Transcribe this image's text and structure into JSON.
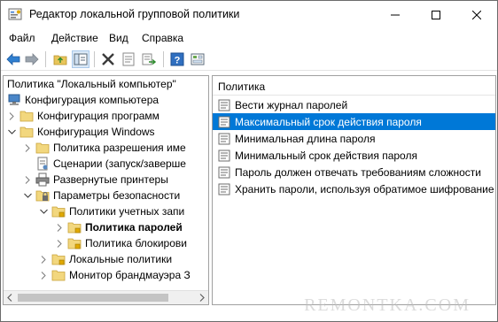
{
  "window": {
    "title": "Редактор локальной групповой политики"
  },
  "menu": {
    "items": [
      "Файл",
      "Действие",
      "Вид",
      "Справка"
    ]
  },
  "left_pane": {
    "header": "Политика \"Локальный компьютер\"",
    "tree": [
      {
        "label": "Конфигурация компьютера",
        "icon": "computer-icon",
        "expanded": true
      },
      {
        "label": "Конфигурация программ",
        "icon": "folder-icon",
        "expanded": false
      },
      {
        "label": "Конфигурация Windows",
        "icon": "folder-icon",
        "expanded": true
      },
      {
        "label": "Политика разрешения име",
        "icon": "folder-icon",
        "expanded": false
      },
      {
        "label": "Сценарии (запуск/заверше",
        "icon": "script-icon",
        "expanded": null
      },
      {
        "label": "Развернутые принтеры",
        "icon": "printer-icon",
        "expanded": false
      },
      {
        "label": "Параметры безопасности",
        "icon": "security-folder-icon",
        "expanded": true
      },
      {
        "label": "Политики учетных запи",
        "icon": "security-folder-icon",
        "expanded": true
      },
      {
        "label": "Политика паролей",
        "icon": "security-folder-icon",
        "expanded": false,
        "selected": true
      },
      {
        "label": "Политика блокирови",
        "icon": "security-folder-icon",
        "expanded": false
      },
      {
        "label": "Локальные политики",
        "icon": "security-folder-icon",
        "expanded": false
      },
      {
        "label": "Монитор брандмауэра З",
        "icon": "folder-icon",
        "expanded": false
      }
    ]
  },
  "right_pane": {
    "header": "Политика",
    "policies": [
      {
        "label": "Вести журнал паролей",
        "selected": false
      },
      {
        "label": "Максимальный срок действия пароля",
        "selected": true
      },
      {
        "label": "Минимальная длина пароля",
        "selected": false
      },
      {
        "label": "Минимальный срок действия пароля",
        "selected": false
      },
      {
        "label": "Пароль должен отвечать требованиям сложности",
        "selected": false
      },
      {
        "label": "Хранить пароли, используя обратимое шифрование",
        "selected": false
      }
    ]
  },
  "watermark": "REMONTKA.COM",
  "colors": {
    "selection": "#0078d7",
    "folder": "#e8c55a",
    "border": "#a0a0a0"
  }
}
